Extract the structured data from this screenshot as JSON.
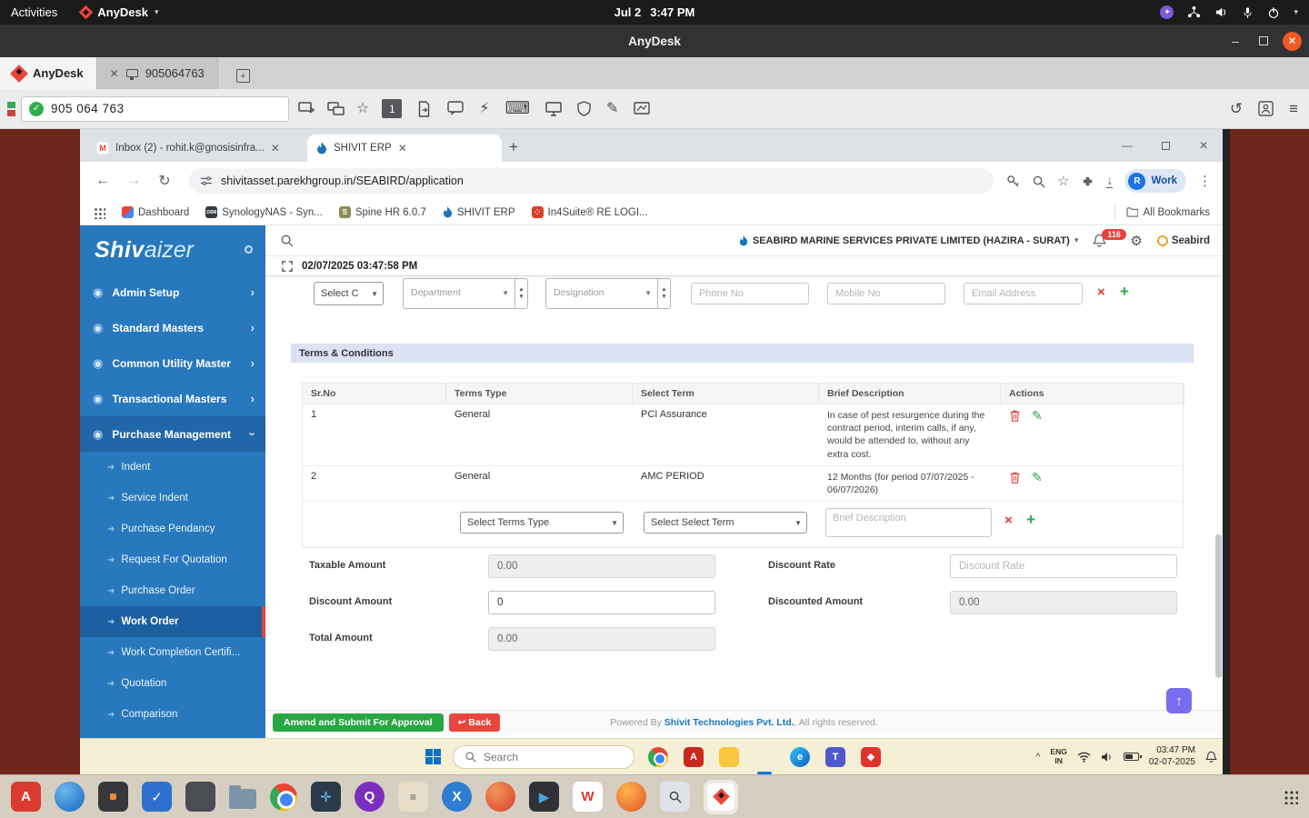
{
  "gnome": {
    "activities": "Activities",
    "app_menu": "AnyDesk",
    "clock_date": "Jul 2",
    "clock_time": "3:47 PM"
  },
  "anydesk": {
    "window_title": "AnyDesk",
    "brand_tab": "AnyDesk",
    "session_tab": "905064763",
    "session_id": "905 064 763",
    "monitor": "1"
  },
  "chrome": {
    "tab_gmail": "Inbox (2) - rohit.k@gnosisinfra...",
    "tab_erp": "SHIVIT ERP",
    "url": "shivitasset.parekhgroup.in/SEABIRD/application",
    "profile_initial": "R",
    "profile_name": "Work",
    "bookmarks": [
      {
        "label": "Dashboard"
      },
      {
        "label": "SynologyNAS - Syn..."
      },
      {
        "label": "Spine HR 6.0.7"
      },
      {
        "label": "SHIVIT ERP"
      },
      {
        "label": "In4Suite® RE LOGI..."
      }
    ],
    "all_bookmarks": "All Bookmarks"
  },
  "erp": {
    "logo_bold": "Shiv",
    "logo_light": "aizer",
    "company": "SEABIRD MARINE SERVICES PRIVATE LIMITED (HAZIRA - SURAT)",
    "notification_count": "116",
    "user_name": "Seabird",
    "timestamp": "02/07/2025 03:47:58 PM",
    "menu": [
      {
        "label": "Admin Setup"
      },
      {
        "label": "Standard Masters"
      },
      {
        "label": "Common Utility Master"
      },
      {
        "label": "Transactional Masters"
      },
      {
        "label": "Purchase Management"
      }
    ],
    "submenu": [
      {
        "label": "Indent"
      },
      {
        "label": "Service Indent"
      },
      {
        "label": "Purchase Pendancy"
      },
      {
        "label": "Request For Quotation"
      },
      {
        "label": "Purchase Order"
      },
      {
        "label": "Work Order"
      },
      {
        "label": "Work Completion Certifi..."
      },
      {
        "label": "Quotation"
      },
      {
        "label": "Comparison"
      }
    ],
    "contact": {
      "select_contact": "Select C",
      "department": "Department",
      "designation": "Designation",
      "phone": "Phone No",
      "mobile": "Mobile No",
      "email": "Email Address"
    },
    "terms": {
      "title": "Terms & Conditions",
      "col_sr": "Sr.No",
      "col_type": "Terms Type",
      "col_term": "Select Term",
      "col_desc": "Brief Description",
      "col_actions": "Actions",
      "rows": [
        {
          "sr": "1",
          "type": "General",
          "term": "PCI Assurance",
          "desc": "In case of pest resurgence during the contract period, interim calls, if any, would be attended to, without any extra cost."
        },
        {
          "sr": "2",
          "type": "General",
          "term": "AMC PERIOD",
          "desc": "12 Months (for period 07/07/2025 - 06/07/2026)"
        }
      ],
      "terms_type_placeholder": "Select Terms Type",
      "select_term_placeholder": "Select Select Term",
      "desc_placeholder": "Brief Description"
    },
    "amounts": {
      "taxable_label": "Taxable Amount",
      "taxable_value": "0.00",
      "discount_rate_label": "Discount Rate",
      "discount_rate_placeholder": "Discount Rate",
      "discount_amount_label": "Discount Amount",
      "discount_amount_value": "0",
      "discounted_label": "Discounted Amount",
      "discounted_value": "0.00",
      "total_label": "Total Amount",
      "total_value": "0.00"
    },
    "footer": {
      "submit": "Amend and Submit For Approval",
      "back": "Back",
      "powered_prefix": "Powered By",
      "powered_link": "Shivit Technologies Pvt. Ltd.",
      "powered_suffix": ", All rights reserved."
    }
  },
  "taskbar": {
    "search": "Search",
    "lang_top": "ENG",
    "lang_bottom": "IN",
    "time": "03:47 PM",
    "date": "02-07-2025"
  }
}
